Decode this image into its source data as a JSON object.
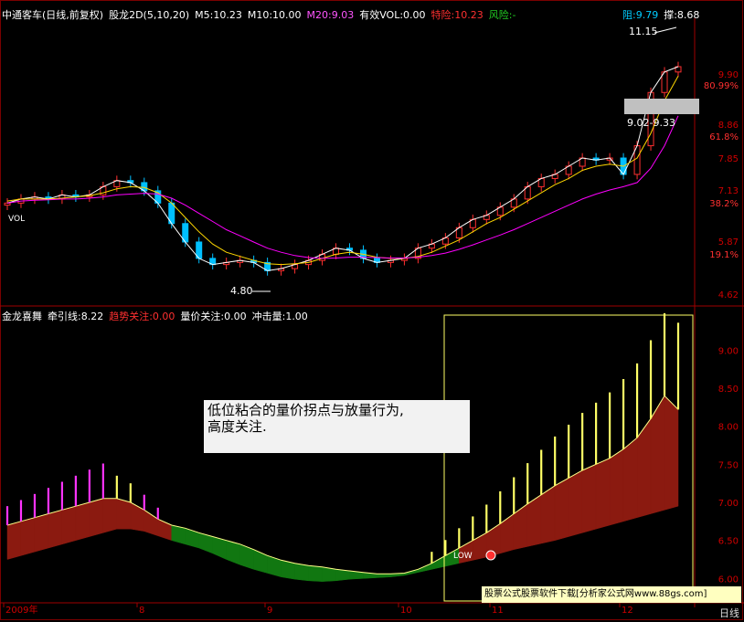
{
  "header_top": {
    "title": "中通客车(日线,前复权)",
    "indicator": "股龙2D(5,10,20)",
    "m5": "M5:10.23",
    "m10": "M10:10.00",
    "m20": "M20:9.03",
    "vol": "有效VOL:0.00",
    "trigger": "特险:10.23",
    "risk": "风险:-",
    "resist": "阻:9.79",
    "support": "撑:8.68"
  },
  "header_bottom": {
    "name": "金龙喜舞",
    "pull": "牵引线:8.22",
    "trend": "趋势关注:0.00",
    "pv": "量价关注:0.00",
    "impact": "冲击量:1.00"
  },
  "note": {
    "line1": "低位粘合的量价拐点与放量行为,",
    "line2": "高度关注."
  },
  "watermark": "股票公式股票软件下载[分析家公式网www.88gs.com]",
  "period_label": "日线",
  "colors": {
    "up": "#ff3030",
    "down": "#00c0ff",
    "ma5": "#ffffff",
    "ma10": "#ffd700",
    "ma20": "#ff00ff",
    "bar_yellow": "#ffff66",
    "bar_magenta": "#ff33ff",
    "area_red": "#8b1a10",
    "area_green": "#117711"
  },
  "chart_data": [
    {
      "type": "candlestick",
      "title": "中通客车(日线,前复权)",
      "y_ticks": [
        "9.90",
        "80.99%",
        "8.86",
        "61.8%",
        "7.85",
        "7.13",
        "38.2%",
        "5.87",
        "19.1%",
        "4.62"
      ],
      "ylim": [
        4.5,
        11.3
      ],
      "annotations": [
        "11.15",
        "9.02-9.33",
        "4.80",
        "VOL"
      ],
      "series": [
        {
          "name": "M5",
          "values": [
            6.9,
            7.0,
            7.05,
            7.0,
            7.1,
            7.05,
            7.1,
            7.3,
            7.45,
            7.4,
            7.2,
            6.9,
            6.4,
            5.95,
            5.55,
            5.4,
            5.45,
            5.5,
            5.45,
            5.25,
            5.3,
            5.4,
            5.5,
            5.65,
            5.8,
            5.75,
            5.55,
            5.45,
            5.5,
            5.55,
            5.8,
            5.9,
            6.05,
            6.3,
            6.5,
            6.6,
            6.8,
            7.0,
            7.3,
            7.5,
            7.6,
            7.8,
            8.0,
            7.95,
            8.0,
            7.6,
            8.3,
            9.6,
            10.1,
            10.23
          ]
        },
        {
          "name": "M10",
          "values": [
            6.95,
            7.0,
            7.0,
            7.0,
            7.02,
            7.05,
            7.08,
            7.15,
            7.25,
            7.3,
            7.28,
            7.15,
            6.9,
            6.55,
            6.2,
            5.9,
            5.7,
            5.6,
            5.5,
            5.42,
            5.4,
            5.42,
            5.45,
            5.55,
            5.65,
            5.7,
            5.65,
            5.58,
            5.55,
            5.55,
            5.6,
            5.7,
            5.85,
            6.0,
            6.2,
            6.4,
            6.55,
            6.75,
            6.95,
            7.15,
            7.35,
            7.5,
            7.7,
            7.8,
            7.85,
            7.8,
            8.0,
            8.6,
            9.4,
            10.0
          ]
        },
        {
          "name": "M20",
          "values": [
            6.9,
            6.95,
            6.97,
            6.98,
            7.0,
            7.0,
            7.02,
            7.05,
            7.1,
            7.12,
            7.14,
            7.12,
            7.02,
            6.85,
            6.65,
            6.45,
            6.25,
            6.1,
            5.95,
            5.8,
            5.7,
            5.62,
            5.57,
            5.55,
            5.56,
            5.58,
            5.58,
            5.57,
            5.56,
            5.56,
            5.58,
            5.62,
            5.68,
            5.77,
            5.88,
            6.0,
            6.12,
            6.25,
            6.4,
            6.55,
            6.7,
            6.85,
            7.0,
            7.12,
            7.22,
            7.3,
            7.4,
            7.75,
            8.3,
            9.03
          ]
        }
      ]
    },
    {
      "type": "area",
      "title": "金龙喜舞",
      "y_ticks": [
        "9.00",
        "8.50",
        "8.00",
        "7.50",
        "7.00",
        "6.50",
        "6.00"
      ],
      "ylim": [
        5.8,
        9.4
      ],
      "x_ticks": [
        "2009年",
        "8",
        "9",
        "10",
        "11",
        "12"
      ],
      "annotations": [
        "LOW"
      ],
      "series": [
        {
          "name": "upper",
          "values": [
            6.7,
            6.75,
            6.8,
            6.85,
            6.9,
            6.95,
            7.0,
            7.05,
            7.05,
            7.0,
            6.9,
            6.78,
            6.7,
            6.66,
            6.6,
            6.55,
            6.5,
            6.45,
            6.38,
            6.3,
            6.24,
            6.2,
            6.17,
            6.15,
            6.12,
            6.1,
            6.08,
            6.06,
            6.06,
            6.07,
            6.12,
            6.2,
            6.3,
            6.4,
            6.5,
            6.6,
            6.72,
            6.85,
            6.98,
            7.1,
            7.22,
            7.32,
            7.42,
            7.5,
            7.58,
            7.7,
            7.85,
            8.1,
            8.4,
            8.22
          ]
        },
        {
          "name": "lower",
          "values": [
            6.25,
            6.3,
            6.35,
            6.4,
            6.45,
            6.5,
            6.55,
            6.6,
            6.65,
            6.65,
            6.62,
            6.56,
            6.5,
            6.45,
            6.4,
            6.33,
            6.25,
            6.18,
            6.12,
            6.07,
            6.02,
            5.99,
            5.97,
            5.96,
            5.97,
            5.99,
            6.0,
            6.01,
            6.02,
            6.04,
            6.08,
            6.12,
            6.16,
            6.2,
            6.24,
            6.28,
            6.33,
            6.38,
            6.42,
            6.46,
            6.5,
            6.55,
            6.6,
            6.65,
            6.7,
            6.75,
            6.8,
            6.85,
            6.9,
            6.95
          ]
        }
      ]
    }
  ]
}
